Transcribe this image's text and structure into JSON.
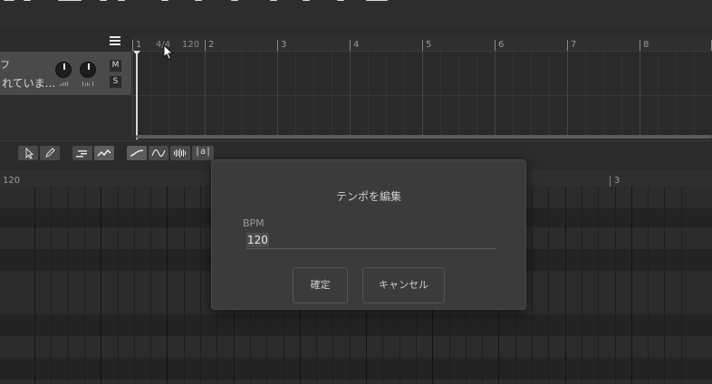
{
  "toolbar_top": {},
  "ruler": {
    "bar_numbers": [
      "1",
      "2",
      "3",
      "4",
      "5",
      "6",
      "7",
      "8"
    ],
    "time_signature": "4/4",
    "tempo": "120"
  },
  "track": {
    "name_partial": "フ",
    "label_partial": "れていま...",
    "mute_label": "M",
    "solo_label": "S"
  },
  "editor_tools": {
    "text_tool_label": "|a|"
  },
  "piano_roll": {
    "tempo_marker": "120",
    "bar_marker": "3"
  },
  "dialog": {
    "title": "テンポを編集",
    "field_label": "BPM",
    "field_value": "120",
    "ok_label": "確定",
    "cancel_label": "キャンセル"
  }
}
